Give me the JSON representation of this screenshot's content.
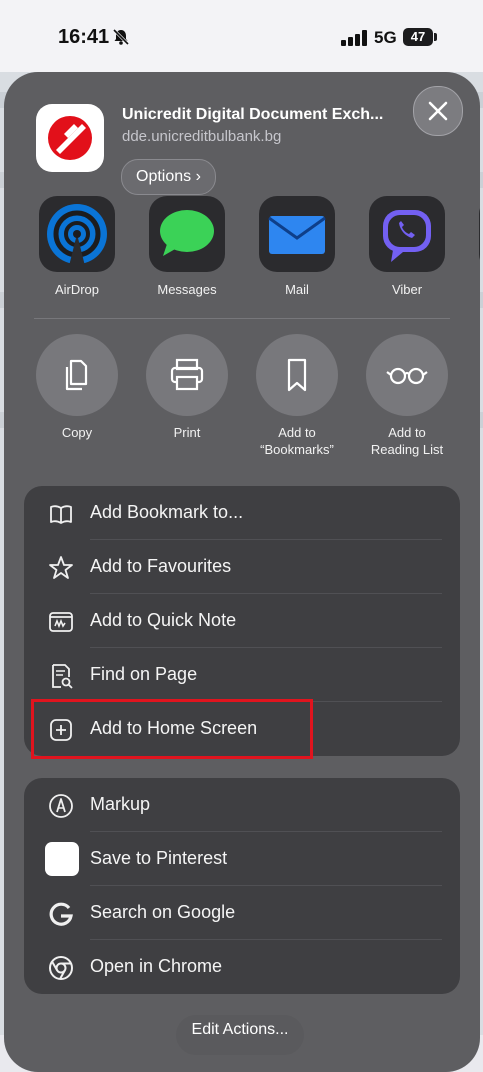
{
  "status_bar": {
    "time": "16:41",
    "network": "5G",
    "battery": "47"
  },
  "header": {
    "title": "Unicredit Digital Document Exch...",
    "url": "dde.unicreditbulbank.bg",
    "options_label": "Options ›",
    "close_icon": "close-icon"
  },
  "share_targets": [
    {
      "label": "AirDrop",
      "icon": "airdrop-icon"
    },
    {
      "label": "Messages",
      "icon": "messages-icon"
    },
    {
      "label": "Mail",
      "icon": "mail-icon"
    },
    {
      "label": "Viber",
      "icon": "viber-icon"
    }
  ],
  "quick_actions": [
    {
      "label": "Copy",
      "icon": "copy-icon"
    },
    {
      "label": "Print",
      "icon": "printer-icon"
    },
    {
      "label": "Add to\n“Bookmarks”",
      "icon": "bookmark-icon"
    },
    {
      "label": "Add to\nReading List",
      "icon": "reading-list-icon"
    }
  ],
  "menu_group_1": [
    {
      "label": "Add Bookmark to...",
      "icon": "book-icon"
    },
    {
      "label": "Add to Favourites",
      "icon": "star-icon"
    },
    {
      "label": "Add to Quick Note",
      "icon": "quick-note-icon"
    },
    {
      "label": "Find on Page",
      "icon": "find-on-page-icon"
    },
    {
      "label": "Add to Home Screen",
      "icon": "add-square-icon"
    }
  ],
  "menu_group_2": [
    {
      "label": "Markup",
      "icon": "markup-icon"
    },
    {
      "label": "Save to Pinterest",
      "icon": "pinterest-icon"
    },
    {
      "label": "Search on Google",
      "icon": "google-icon"
    },
    {
      "label": "Open in Chrome",
      "icon": "chrome-icon"
    }
  ],
  "footer": {
    "edit_actions_label": "Edit Actions..."
  },
  "colors": {
    "sheet": "#5e5e61",
    "menu_group": "#3f3f42",
    "highlight": "#e0141e",
    "brand_red": "#e2101a"
  }
}
